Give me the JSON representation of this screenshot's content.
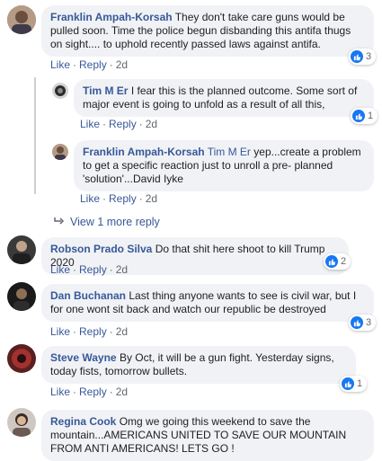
{
  "comments": [
    {
      "author": "Franklin Ampah-Korsah",
      "text": "They don't take care guns would be pulled soon. Time the police begun disbanding this antifa thugs on sight.... to uphold recently passed laws against antifa.",
      "like": "Like",
      "reply": "Reply",
      "time": "2d",
      "reactions": "3"
    },
    {
      "author": "Tim M Er",
      "text": "I fear this is the planned outcome. Some sort of major event is going to unfold as a result of all this,",
      "like": "Like",
      "reply": "Reply",
      "time": "2d",
      "reactions": "1"
    },
    {
      "author": "Franklin Ampah-Korsah",
      "mention": "Tim M Er",
      "text": "yep...create a problem to get a specific reaction just to unroll a pre- planned 'solution'...David Iyke",
      "like": "Like",
      "reply": "Reply",
      "time": "2d"
    },
    {
      "author": "Robson Prado Silva",
      "text": "Do that shit here shoot to kill Trump 2020",
      "like": "Like",
      "reply": "Reply",
      "time": "2d",
      "reactions": "2"
    },
    {
      "author": "Dan Buchanan",
      "text": "Last thing anyone wants to see is civil war, but I for one wont sit back and watch our republic be destroyed",
      "like": "Like",
      "reply": "Reply",
      "time": "2d",
      "reactions": "3"
    },
    {
      "author": "Steve Wayne",
      "text": "By Oct, it will be a gun fight. Yesterday signs, today fists, tomorrow bullets.",
      "like": "Like",
      "reply": "Reply",
      "time": "2d",
      "reactions": "1"
    },
    {
      "author": "Regina Cook",
      "text": "Omg we going this weekend to save the mountain...AMERICANS UNITED TO SAVE OUR MOUNTAIN FROM ANTI AMERICANS! LETS GO !"
    }
  ],
  "view_more": "View 1 more reply",
  "colors": {
    "link": "#385898",
    "bubble": "#f0f2f5",
    "like_blue": "#1877f2"
  }
}
